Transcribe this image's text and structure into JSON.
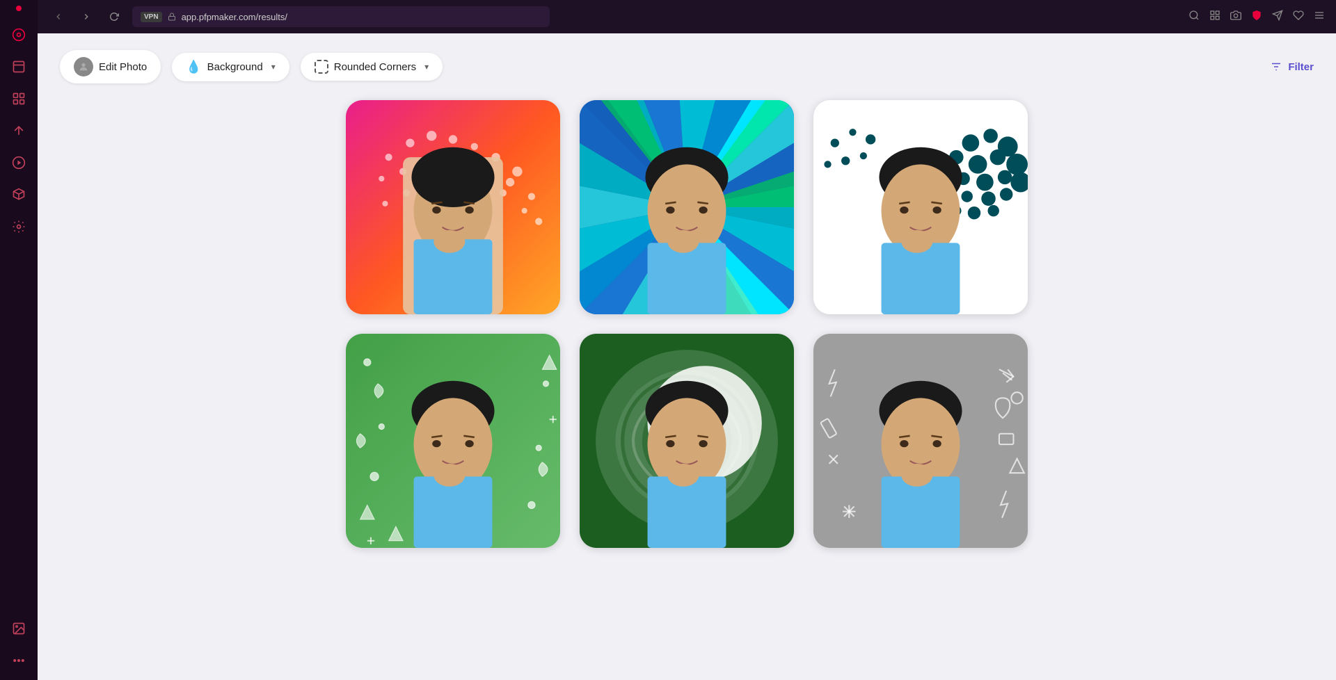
{
  "browser": {
    "url": "app.pfpmaker.com/results/",
    "vpn_label": "VPN"
  },
  "toolbar": {
    "edit_photo_label": "Edit Photo",
    "background_label": "Background",
    "rounded_corners_label": "Rounded Corners",
    "filter_label": "Filter"
  },
  "sidebar": {
    "items": [
      {
        "name": "home",
        "icon": "⊙"
      },
      {
        "name": "shopping",
        "icon": "🛍"
      },
      {
        "name": "camera-frame",
        "icon": "⊡"
      },
      {
        "name": "navigation",
        "icon": "⌃"
      },
      {
        "name": "play-circle",
        "icon": "▷"
      },
      {
        "name": "box",
        "icon": "⬡"
      },
      {
        "name": "settings",
        "icon": "⚙"
      },
      {
        "name": "gallery",
        "icon": "▦"
      },
      {
        "name": "more",
        "icon": "…"
      }
    ]
  },
  "results": {
    "cards": [
      {
        "id": 1,
        "bg_type": "gradient_pink_orange",
        "pattern": "dots_grid"
      },
      {
        "id": 2,
        "bg_type": "rays_blue_green",
        "pattern": "rays"
      },
      {
        "id": 3,
        "bg_type": "white_dots",
        "pattern": "halftone"
      },
      {
        "id": 4,
        "bg_type": "green_scatter",
        "pattern": "symbols"
      },
      {
        "id": 5,
        "bg_type": "dark_green_swirl",
        "pattern": "swirl"
      },
      {
        "id": 6,
        "bg_type": "gray_doodle",
        "pattern": "doodles"
      }
    ]
  }
}
